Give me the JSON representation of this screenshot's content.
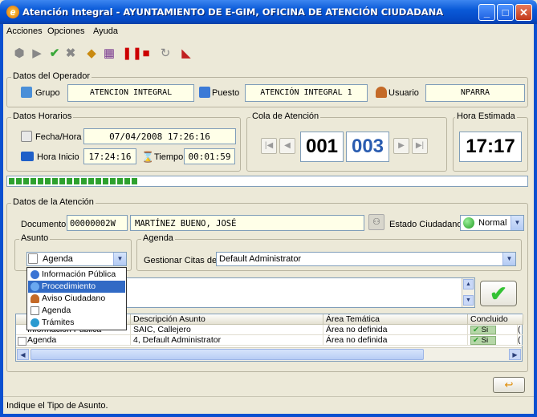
{
  "window": {
    "title": "Atención Integral - AYUNTAMIENTO DE E-GIM, OFICINA DE ATENCIÓN CIUDADANA"
  },
  "menu": [
    "Acciones",
    "Opciones",
    "Ayuda"
  ],
  "operador": {
    "legend": "Datos del Operador",
    "grupo_label": "Grupo",
    "grupo_value": "ATENCION INTEGRAL",
    "puesto_label": "Puesto",
    "puesto_value": "ATENCIÓN INTEGRAL 1",
    "usuario_label": "Usuario",
    "usuario_value": "NPARRA"
  },
  "horarios": {
    "legend": "Datos Horarios",
    "fecha_label": "Fecha/Hora",
    "fecha_value": "07/04/2008 17:26:16",
    "inicio_label": "Hora Inicio",
    "inicio_value": "17:24:16",
    "tiempo_label": "Tiempo",
    "tiempo_value": "00:01:59"
  },
  "cola": {
    "legend": "Cola de Atención",
    "current": "001",
    "total": "003"
  },
  "estimada": {
    "legend": "Hora Estimada",
    "value": "17:17"
  },
  "progress": {
    "fraction": 0.25
  },
  "atencion": {
    "legend": "Datos de la Atención",
    "documento_label": "Documento",
    "documento_value": "00000002W",
    "nombre_value": "MARTÍNEZ BUENO, JOSÉ",
    "estado_label": "Estado Ciudadano",
    "estado_value": "Normal"
  },
  "asunto": {
    "legend": "Asunto",
    "selected": "Agenda",
    "options": [
      "Información Pública",
      "Procedimiento",
      "Aviso Ciudadano",
      "Agenda",
      "Trámites"
    ],
    "highlighted": "Procedimiento"
  },
  "agenda": {
    "legend": "Agenda",
    "gestionar_label": "Gestionar Citas de",
    "gestionar_value": "Default Administrator"
  },
  "table": {
    "headers": [
      "Descripción Asunto",
      "Área Temática",
      "Concluido"
    ],
    "rows": [
      {
        "tipo": "Información Pública",
        "descripcion": "SAIC, Callejero",
        "area": "Área no definida",
        "concluido": "Si"
      },
      {
        "tipo": "Agenda",
        "descripcion": "4, Default Administrator",
        "area": "Área no definida",
        "concluido": "Si"
      }
    ],
    "trailing": [
      "(",
      "("
    ]
  },
  "status": {
    "text": "Indique el Tipo de Asunto."
  },
  "colors": {
    "titlebar": "#0a5ad8",
    "field_bg": "#ffffe8",
    "highlight": "#316ac5",
    "progress": "#2ea12e",
    "success": "#34c234"
  }
}
